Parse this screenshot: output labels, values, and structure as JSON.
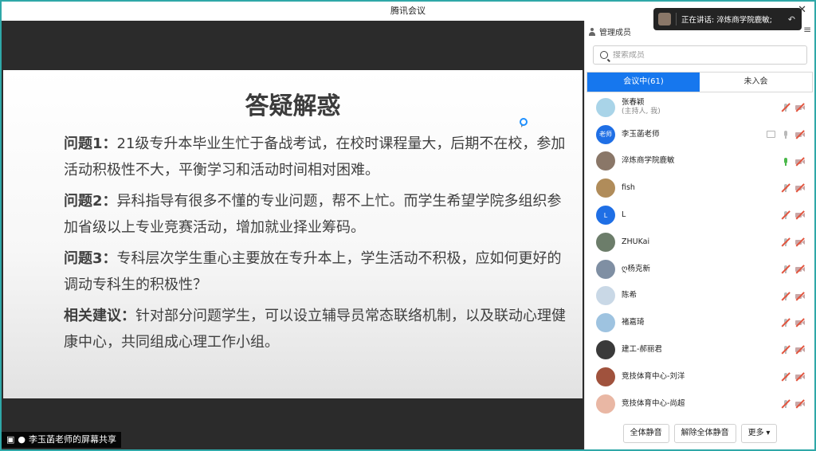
{
  "window": {
    "title": "腾讯会议",
    "close_glyph": "✕"
  },
  "notice": {
    "text": "正在讲话: 淬炼商学院鹿敏;",
    "back_glyph": "↶"
  },
  "slide": {
    "title": "答疑解惑",
    "paragraphs": [
      {
        "label": "问题1：",
        "text": "21级专升本毕业生忙于备战考试，在校时课程量大，后期不在校，参加活动积极性不大，平衡学习和活动时间相对困难。"
      },
      {
        "label": "问题2：",
        "text": "异科指导有很多不懂的专业问题，帮不上忙。而学生希望学院多组织参加省级以上专业竞赛活动，增加就业择业筹码。"
      },
      {
        "label": "问题3：",
        "text": "专科层次学生重心主要放在专升本上，学生活动不积极，应如何更好的调动专科生的积极性？"
      },
      {
        "label": "相关建议：",
        "text": "针对部分问题学生，可以设立辅导员常态联络机制，以及联动心理健康中心，共同组成心理工作小组。"
      }
    ]
  },
  "share_footer": {
    "label": "李玉菡老师的屏幕共享"
  },
  "panel": {
    "title": "管理成员",
    "menu_glyph": "≡",
    "search_placeholder": "搜索成员",
    "tabs": [
      {
        "label": "会议中(61)"
      },
      {
        "label": "未入会"
      }
    ],
    "members": [
      {
        "name": "张春颖",
        "sub": "(主持人, 我)",
        "avatar_text": "",
        "avatar_color": "#a9d4e8",
        "mic": "muted",
        "screen": false
      },
      {
        "name": "李玉菡老师",
        "sub": "",
        "avatar_text": "老师",
        "avatar_color": "#1f6fe5",
        "mic": "off",
        "screen": true
      },
      {
        "name": "淬炼商学院鹿敏",
        "sub": "",
        "avatar_text": "",
        "avatar_color": "#8a7768",
        "mic": "active",
        "screen": false
      },
      {
        "name": "fish",
        "sub": "",
        "avatar_text": "",
        "avatar_color": "#b08c5a",
        "mic": "muted",
        "screen": false
      },
      {
        "name": "L",
        "sub": "",
        "avatar_text": "L",
        "avatar_color": "#1f6fe5",
        "mic": "muted",
        "screen": false
      },
      {
        "name": "ZHUKai",
        "sub": "",
        "avatar_text": "",
        "avatar_color": "#6c7d6a",
        "mic": "muted",
        "screen": false
      },
      {
        "name": "ღ杨克新",
        "sub": "",
        "avatar_text": "",
        "avatar_color": "#7f8fa3",
        "mic": "muted",
        "screen": false
      },
      {
        "name": "陈希",
        "sub": "",
        "avatar_text": "",
        "avatar_color": "#c9d8e6",
        "mic": "muted",
        "screen": false
      },
      {
        "name": "褚嘉琦",
        "sub": "",
        "avatar_text": "",
        "avatar_color": "#9ec3e0",
        "mic": "muted",
        "screen": false
      },
      {
        "name": "建工-郝丽君",
        "sub": "",
        "avatar_text": "",
        "avatar_color": "#3a3a3a",
        "mic": "muted",
        "screen": false
      },
      {
        "name": "竞技体育中心-刘洋",
        "sub": "",
        "avatar_text": "",
        "avatar_color": "#a0523d",
        "mic": "muted",
        "screen": false
      },
      {
        "name": "竞技体育中心-尚超",
        "sub": "",
        "avatar_text": "",
        "avatar_color": "#e9b7a4",
        "mic": "muted",
        "screen": false
      }
    ],
    "footer_buttons": [
      {
        "label": "全体静音"
      },
      {
        "label": "解除全体静音"
      },
      {
        "label": "更多 ▾"
      }
    ]
  }
}
